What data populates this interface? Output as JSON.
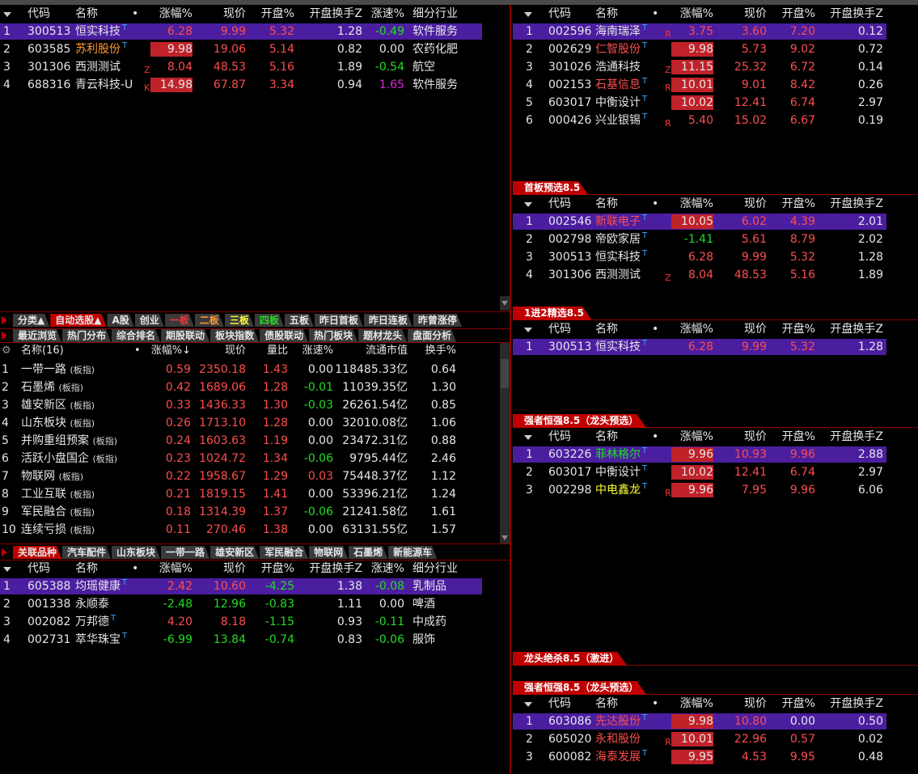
{
  "top_tabs": [
    "",
    "",
    "",
    "",
    "",
    "",
    "",
    "",
    "",
    "",
    "",
    "",
    "",
    "",
    ""
  ],
  "left_top": {
    "headers": {
      "code": "代码",
      "name": "名称",
      "dot": "•",
      "chg": "涨幅%",
      "price": "现价",
      "open": "开盘%",
      "turn": "开盘换手Z",
      "speed": "涨速%",
      "ind": "细分行业"
    },
    "rows": [
      {
        "n": "1",
        "code": "300513",
        "name": "恒实科技",
        "mark": "",
        "chg": "6.28",
        "price": "9.99",
        "open": "5.32",
        "turn": "1.28",
        "speed": "-0.49",
        "ind": "软件服务"
      },
      {
        "n": "2",
        "code": "603585",
        "name": "苏利股份",
        "mark": "",
        "chg": "9.98",
        "price": "19.06",
        "open": "5.14",
        "turn": "0.82",
        "speed": "0.00",
        "ind": "农药化肥"
      },
      {
        "n": "3",
        "code": "301306",
        "name": "西测测试",
        "mark": "Z",
        "chg": "8.04",
        "price": "48.53",
        "open": "5.16",
        "turn": "1.89",
        "speed": "-0.54",
        "ind": "航空"
      },
      {
        "n": "4",
        "code": "688316",
        "name": "青云科技-U",
        "mark": "K",
        "chg": "14.98",
        "price": "67.87",
        "open": "3.34",
        "turn": "0.94",
        "speed": "1.65",
        "ind": "软件服务"
      }
    ]
  },
  "right_1": {
    "headers": {
      "code": "代码",
      "name": "名称",
      "dot": "•",
      "chg": "涨幅%",
      "price": "现价",
      "open": "开盘%",
      "turn": "开盘换手Z"
    },
    "rows": [
      {
        "n": "1",
        "code": "002596",
        "name": "海南瑞泽",
        "mark": "R",
        "chg": "3.75",
        "price": "3.60",
        "open": "7.20",
        "turn": "0.12"
      },
      {
        "n": "2",
        "code": "002629",
        "name": "仁智股份",
        "mark": "",
        "chg": "9.98",
        "price": "5.73",
        "open": "9.02",
        "turn": "0.72"
      },
      {
        "n": "3",
        "code": "301026",
        "name": "浩通科技",
        "mark": "Z",
        "chg": "11.15",
        "price": "25.32",
        "open": "6.72",
        "turn": "0.14"
      },
      {
        "n": "4",
        "code": "002153",
        "name": "石基信息",
        "mark": "R",
        "chg": "10.01",
        "price": "9.01",
        "open": "8.42",
        "turn": "0.26"
      },
      {
        "n": "5",
        "code": "603017",
        "name": "中衡设计",
        "mark": "",
        "chg": "10.02",
        "price": "12.41",
        "open": "6.74",
        "turn": "2.97"
      },
      {
        "n": "6",
        "code": "000426",
        "name": "兴业银锡",
        "mark": "R",
        "chg": "5.40",
        "price": "15.02",
        "open": "6.67",
        "turn": "0.19"
      }
    ]
  },
  "right_2": {
    "title": "首板预选8.5",
    "rows": [
      {
        "n": "1",
        "code": "002546",
        "name": "新联电子",
        "mark": "",
        "chg": "10.05",
        "price": "6.02",
        "open": "4.39",
        "turn": "2.01"
      },
      {
        "n": "2",
        "code": "002798",
        "name": "帝欧家居",
        "mark": "",
        "chg": "-1.41",
        "price": "5.61",
        "open": "8.79",
        "turn": "2.02"
      },
      {
        "n": "3",
        "code": "300513",
        "name": "恒实科技",
        "mark": "",
        "chg": "6.28",
        "price": "9.99",
        "open": "5.32",
        "turn": "1.28"
      },
      {
        "n": "4",
        "code": "301306",
        "name": "西测测试",
        "mark": "Z",
        "chg": "8.04",
        "price": "48.53",
        "open": "5.16",
        "turn": "1.89"
      }
    ]
  },
  "right_3": {
    "title": "1进2精选8.5",
    "rows": [
      {
        "n": "1",
        "code": "300513",
        "name": "恒实科技",
        "mark": "",
        "chg": "6.28",
        "price": "9.99",
        "open": "5.32",
        "turn": "1.28"
      }
    ]
  },
  "right_4": {
    "title": "强者恒强8.5（龙头预选）",
    "rows": [
      {
        "n": "1",
        "code": "603226",
        "name": "菲林格尔",
        "mark": "",
        "chg": "9.96",
        "price": "10.93",
        "open": "9.96",
        "turn": "2.88"
      },
      {
        "n": "2",
        "code": "603017",
        "name": "中衡设计",
        "mark": "",
        "chg": "10.02",
        "price": "12.41",
        "open": "6.74",
        "turn": "2.97"
      },
      {
        "n": "3",
        "code": "002298",
        "name": "中电鑫龙",
        "mark": "R",
        "chg": "9.96",
        "price": "7.95",
        "open": "9.96",
        "turn": "6.06"
      }
    ]
  },
  "right_5": {
    "title": "龙头绝杀8.5（激进）"
  },
  "right_6": {
    "title": "强者恒强8.5（龙头预选）",
    "rows": [
      {
        "n": "1",
        "code": "603086",
        "name": "先达股份",
        "mark": "",
        "chg": "9.98",
        "price": "10.80",
        "open": "0.00",
        "turn": "0.50"
      },
      {
        "n": "2",
        "code": "605020",
        "name": "永和股份",
        "mark": "R",
        "chg": "10.01",
        "price": "22.96",
        "open": "0.57",
        "turn": "0.02"
      },
      {
        "n": "3",
        "code": "600082",
        "name": "海泰发展",
        "mark": "",
        "chg": "9.95",
        "price": "4.53",
        "open": "9.95",
        "turn": "0.48"
      }
    ]
  },
  "tabs_row1": [
    "分类▲",
    "自动选股▲",
    "A股",
    "创业",
    "一板",
    "二板",
    "三板",
    "四板",
    "五板",
    "昨日首板",
    "昨日连板",
    "昨曾涨停"
  ],
  "tabs_row2": [
    "最近浏览",
    "热门分布",
    "综合排名",
    "期股联动",
    "板块指数",
    "债股联动",
    "热门板块",
    "题材龙头",
    "盘面分析"
  ],
  "sector": {
    "headers": {
      "name": "名称(16)",
      "dot": "•",
      "chg": "涨幅%↓",
      "price": "现价",
      "vol": "量比",
      "speed": "涨速%",
      "cap": "流通市值",
      "turn": "换手%"
    },
    "tag": "(板指)",
    "unit": "亿",
    "rows": [
      {
        "n": "1",
        "name": "一带一路",
        "chg": "0.59",
        "price": "2350.18",
        "vol": "1.43",
        "speed": "0.00",
        "cap": "118485.33",
        "turn": "0.64"
      },
      {
        "n": "2",
        "name": "石墨烯",
        "chg": "0.42",
        "price": "1689.06",
        "vol": "1.28",
        "speed": "-0.01",
        "cap": "11039.35",
        "turn": "1.30"
      },
      {
        "n": "3",
        "name": "雄安新区",
        "chg": "0.33",
        "price": "1436.33",
        "vol": "1.30",
        "speed": "-0.03",
        "cap": "26261.54",
        "turn": "0.85"
      },
      {
        "n": "4",
        "name": "山东板块",
        "chg": "0.26",
        "price": "1713.10",
        "vol": "1.28",
        "speed": "0.00",
        "cap": "32010.08",
        "turn": "1.06"
      },
      {
        "n": "5",
        "name": "并购重组预案",
        "chg": "0.24",
        "price": "1603.63",
        "vol": "1.19",
        "speed": "0.00",
        "cap": "23472.31",
        "turn": "0.88"
      },
      {
        "n": "6",
        "name": "活跃小盘国企",
        "chg": "0.23",
        "price": "1024.72",
        "vol": "1.34",
        "speed": "-0.06",
        "cap": "9795.44",
        "turn": "2.46"
      },
      {
        "n": "7",
        "name": "物联网",
        "chg": "0.22",
        "price": "1958.67",
        "vol": "1.29",
        "speed": "0.03",
        "cap": "75448.37",
        "turn": "1.12"
      },
      {
        "n": "8",
        "name": "工业互联",
        "chg": "0.21",
        "price": "1819.15",
        "vol": "1.41",
        "speed": "0.00",
        "cap": "53396.21",
        "turn": "1.24"
      },
      {
        "n": "9",
        "name": "军民融合",
        "chg": "0.18",
        "price": "1314.39",
        "vol": "1.37",
        "speed": "-0.06",
        "cap": "21241.58",
        "turn": "1.61"
      },
      {
        "n": "10",
        "name": "连续亏损",
        "chg": "0.11",
        "price": "270.46",
        "vol": "1.38",
        "speed": "0.00",
        "cap": "63131.55",
        "turn": "1.57"
      }
    ]
  },
  "tabs_row3": [
    "关联品种",
    "汽车配件",
    "山东板块",
    "一带一路",
    "雄安新区",
    "军民融合",
    "物联网",
    "石墨烯",
    "新能源车"
  ],
  "left_bottom": {
    "rows": [
      {
        "n": "1",
        "code": "605388",
        "name": "均瑶健康",
        "mark": "",
        "chg": "2.42",
        "price": "10.60",
        "open": "-4.25",
        "turn": "1.38",
        "speed": "-0.08",
        "ind": "乳制品"
      },
      {
        "n": "2",
        "code": "001338",
        "name": "永顺泰",
        "mark": "",
        "chg": "-2.48",
        "price": "12.96",
        "open": "-0.83",
        "turn": "1.11",
        "speed": "0.00",
        "ind": "啤酒"
      },
      {
        "n": "3",
        "code": "002082",
        "name": "万邦德",
        "mark": "",
        "chg": "4.20",
        "price": "8.18",
        "open": "-1.15",
        "turn": "0.93",
        "speed": "-0.11",
        "ind": "中成药"
      },
      {
        "n": "4",
        "code": "002731",
        "name": "萃华珠宝",
        "mark": "",
        "chg": "-6.99",
        "price": "13.84",
        "open": "-0.74",
        "turn": "0.83",
        "speed": "-0.06",
        "ind": "服饰"
      }
    ]
  },
  "colors": {
    "accent_red": "#c00000",
    "select_purple": "#4b1ea0",
    "up": "#ff4d4d",
    "down": "#22dd22"
  }
}
